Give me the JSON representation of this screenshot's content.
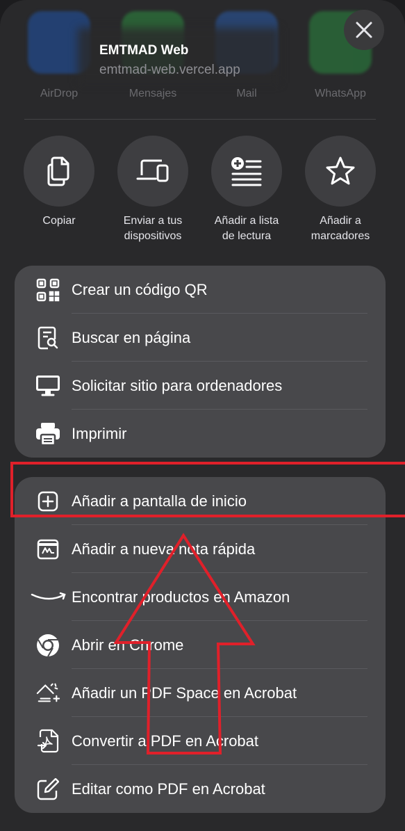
{
  "share_sheet": {
    "apps": [
      {
        "label": "AirDrop",
        "color": "#1c6ef2"
      },
      {
        "label": "Mensajes",
        "color": "#2fc84d"
      },
      {
        "label": "Mail",
        "color": "#2a77f0"
      },
      {
        "label": "WhatsApp",
        "color": "#2ac24b"
      }
    ],
    "title": "EMTMAD Web",
    "subtitle": "emtmad-web.vercel.app",
    "close_icon": "close-icon",
    "actions": [
      {
        "label": "Copiar",
        "icon": "copy-icon"
      },
      {
        "label": "Enviar a tus\ndispositivos",
        "icon": "devices-icon"
      },
      {
        "label": "Añadir a lista\nde lectura",
        "icon": "reading-list-icon"
      },
      {
        "label": "Añadir a\nmarcadores",
        "icon": "star-icon"
      }
    ],
    "group1": [
      {
        "label": "Crear un código QR",
        "icon": "qr-code-icon"
      },
      {
        "label": "Buscar en página",
        "icon": "find-in-page-icon"
      },
      {
        "label": "Solicitar sitio para ordenadores",
        "icon": "desktop-icon"
      },
      {
        "label": "Imprimir",
        "icon": "printer-icon"
      }
    ],
    "group2": [
      {
        "label": "Añadir a pantalla de inicio",
        "icon": "add-square-icon"
      },
      {
        "label": "Añadir a nueva nota rápida",
        "icon": "quick-note-icon"
      },
      {
        "label": "Encontrar productos en Amazon",
        "icon": "amazon-icon"
      },
      {
        "label": "Abrir en Chrome",
        "icon": "chrome-icon"
      },
      {
        "label": "Añadir un PDF Space en Acrobat",
        "icon": "pdf-space-icon"
      },
      {
        "label": "Convertir a PDF en Acrobat",
        "icon": "convert-pdf-icon"
      },
      {
        "label": "Editar como PDF en Acrobat",
        "icon": "edit-pdf-icon"
      }
    ]
  },
  "annotation": {
    "color": "#e0202a"
  }
}
